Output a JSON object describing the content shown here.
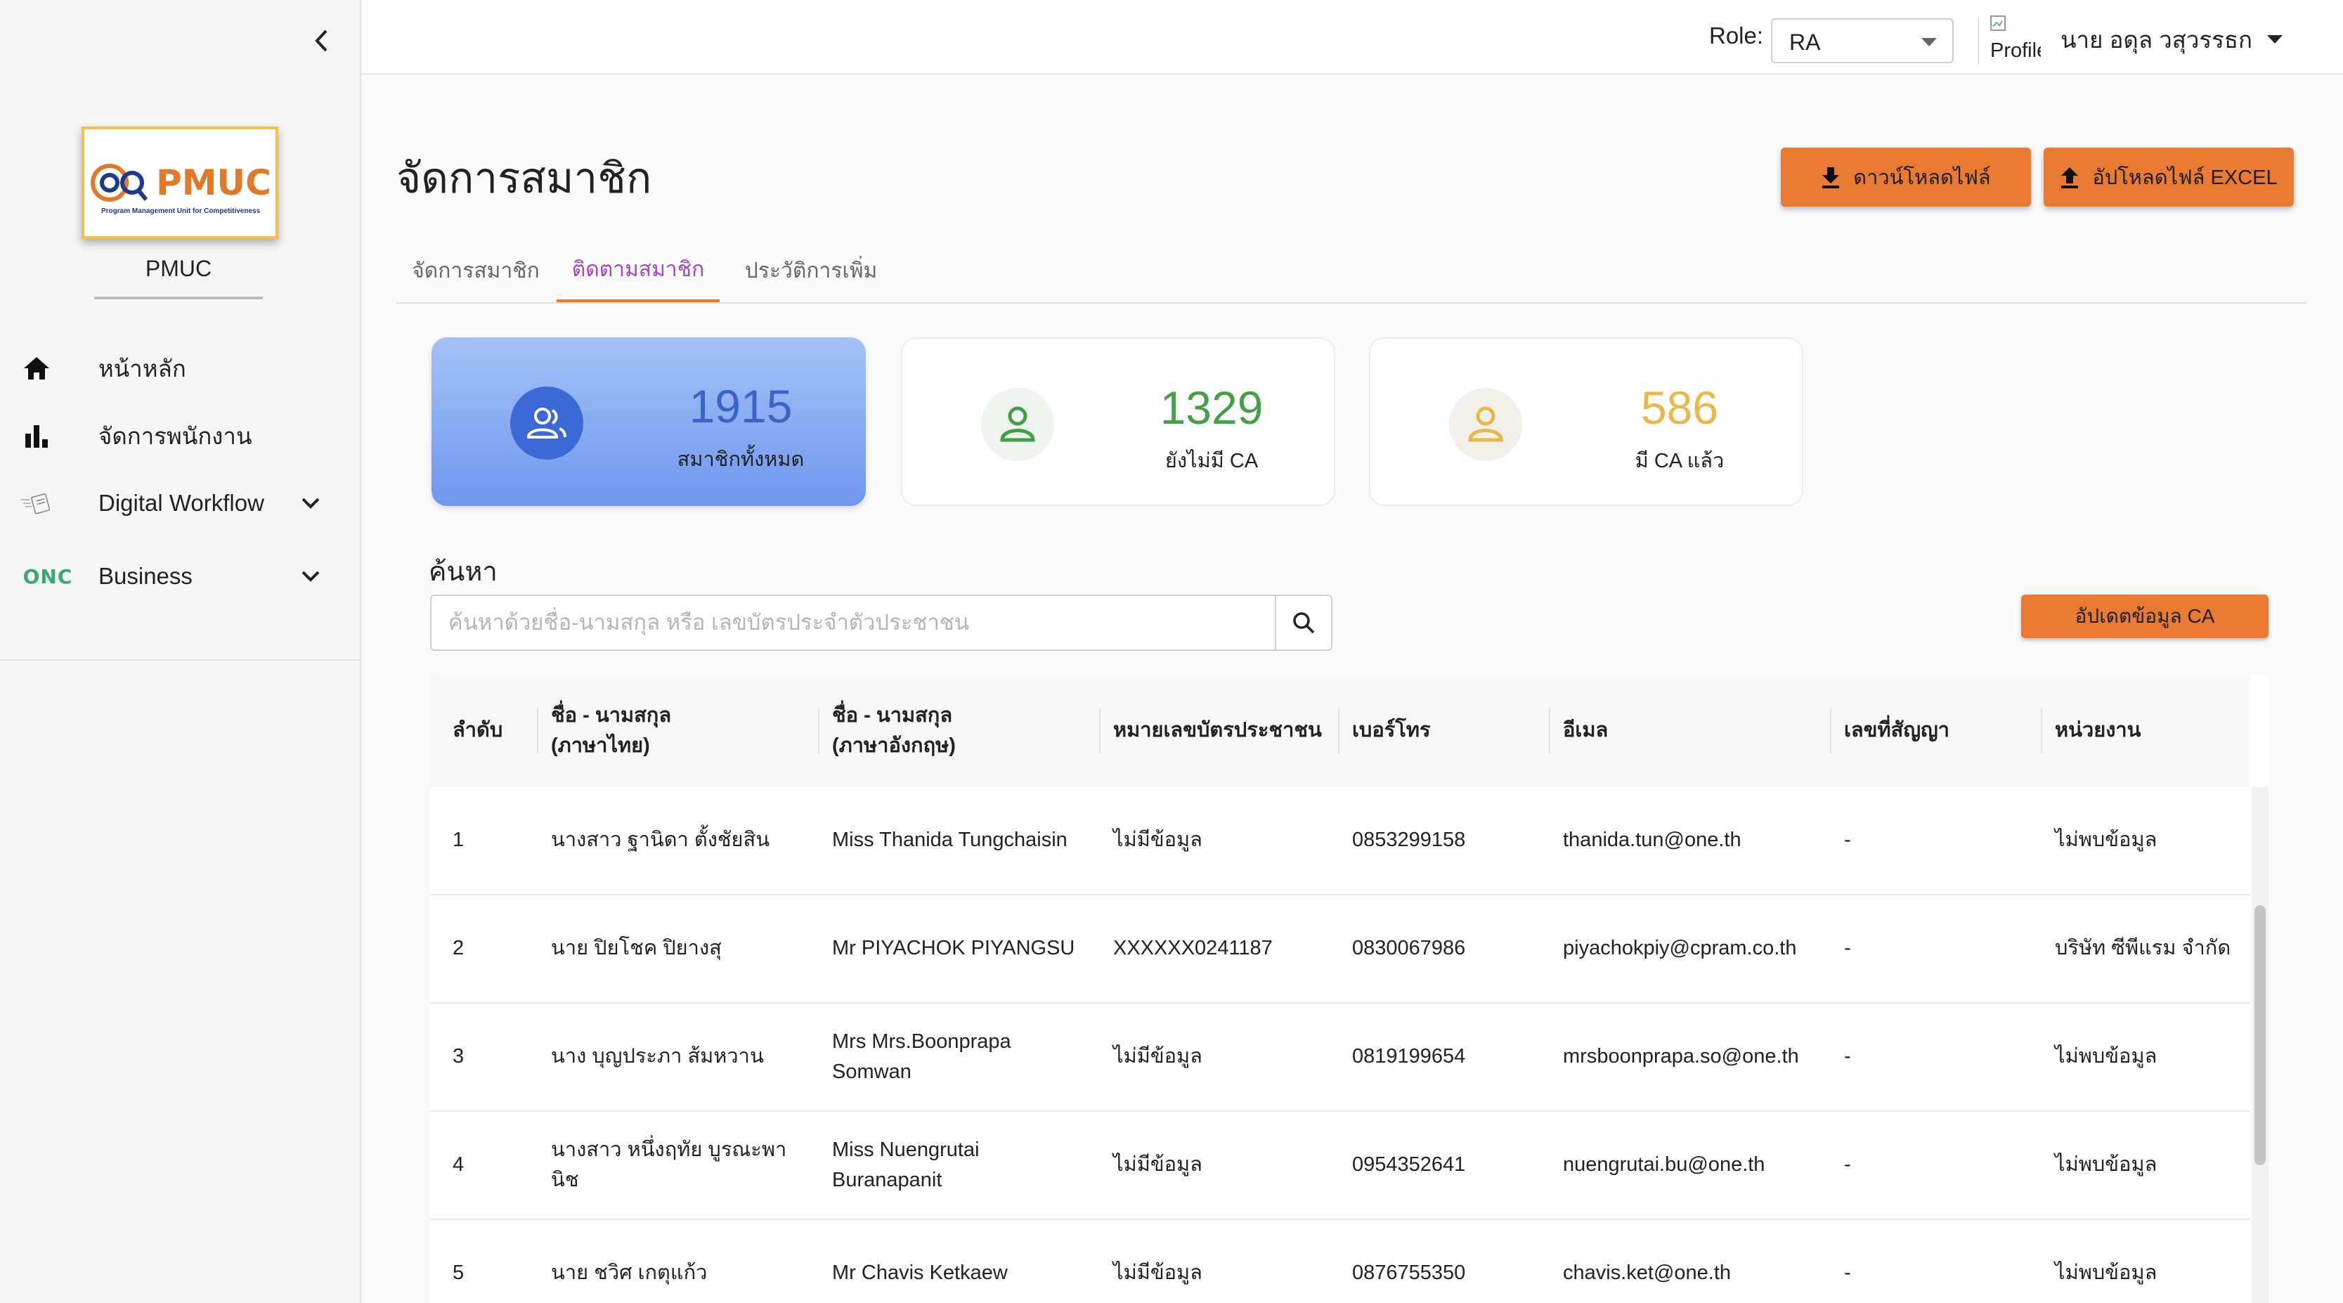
{
  "sidebar": {
    "logo_text": "PMUC",
    "logo_subtitle": "Program Management Unit for Competitiveness",
    "org_name": "PMUC",
    "items": [
      {
        "label": "หน้าหลัก",
        "icon": "home-icon"
      },
      {
        "label": "จัดการพนักงาน",
        "icon": "bar-chart-icon"
      },
      {
        "label": "Digital Workflow",
        "icon": "digital-workflow-icon",
        "expandable": true
      },
      {
        "label": "Business",
        "icon": "onc-logo-icon",
        "expandable": true
      }
    ],
    "onc_text": "ONC"
  },
  "topbar": {
    "role_label": "Role:",
    "role_value": "RA",
    "profile_alt": "Profile",
    "user_name": "นาย อดุล วสุวรรธก"
  },
  "main": {
    "title": "จัดการสมาชิก",
    "download_label": "ดาวน์โหลดไฟล์",
    "upload_label": "อัปโหลดไฟล์ EXCEL",
    "tabs": [
      {
        "label": "จัดการสมาชิก",
        "active": false
      },
      {
        "label": "ติดตามสมาชิก",
        "active": true
      },
      {
        "label": "ประวัติการเพิ่ม",
        "active": false
      }
    ],
    "stats": [
      {
        "value": "1915",
        "label": "สมาชิกทั้งหมด",
        "color": "#3b63c4"
      },
      {
        "value": "1329",
        "label": "ยังไม่มี CA",
        "color": "#43a047"
      },
      {
        "value": "586",
        "label": "มี CA แล้ว",
        "color": "#e8b94a"
      }
    ],
    "search_label": "ค้นหา",
    "search_placeholder": "ค้นหาด้วยชื่อ-นามสกุล หรือ เลขบัตรประจำตัวประชาชน",
    "update_ca_label": "อัปเดตข้อมูล CA"
  },
  "table": {
    "headers": {
      "no": "ลำดับ",
      "name_th_1": "ชื่อ - นามสกุล",
      "name_th_2": "(ภาษาไทย)",
      "name_en_1": "ชื่อ - นามสกุล",
      "name_en_2": "(ภาษาอังกฤษ)",
      "id_card": "หมายเลขบัตรประชาชน",
      "phone": "เบอร์โทร",
      "email": "อีเมล",
      "contract": "เลขที่สัญญา",
      "org": "หน่วยงาน"
    },
    "rows": [
      {
        "no": "1",
        "name_th": "นางสาว ฐานิดา ตั้งชัยสิน",
        "name_en": "Miss Thanida Tungchaisin",
        "id_card": "ไม่มีข้อมูล",
        "phone": "0853299158",
        "email": "thanida.tun@one.th",
        "contract": "-",
        "org": "ไม่พบข้อมูล"
      },
      {
        "no": "2",
        "name_th": "นาย ปิยโชค ปิยางสุ",
        "name_en": "Mr PIYACHOK PIYANGSU",
        "id_card": "XXXXXX0241187",
        "phone": "0830067986",
        "email": "piyachokpiy@cpram.co.th",
        "contract": "-",
        "org": "บริษัท ซีพีแรม จำกัด"
      },
      {
        "no": "3",
        "name_th": "นาง บุญประภา ส้มหวาน",
        "name_en": "Mrs Mrs.Boonprapa Somwan",
        "id_card": "ไม่มีข้อมูล",
        "phone": "0819199654",
        "email": "mrsboonprapa.so@one.th",
        "contract": "-",
        "org": "ไม่พบข้อมูล"
      },
      {
        "no": "4",
        "name_th": "นางสาว หนึ่งฤทัย บูรณะพานิช",
        "name_en": "Miss Nuengrutai Buranapanit",
        "id_card": "ไม่มีข้อมูล",
        "phone": "0954352641",
        "email": "nuengrutai.bu@one.th",
        "contract": "-",
        "org": "ไม่พบข้อมูล"
      },
      {
        "no": "5",
        "name_th": "นาย ชวิศ เกตุแก้ว",
        "name_en": "Mr Chavis Ketkaew",
        "id_card": "ไม่มีข้อมูล",
        "phone": "0876755350",
        "email": "chavis.ket@one.th",
        "contract": "-",
        "org": "ไม่พบข้อมูล"
      }
    ]
  },
  "colors": {
    "accent_orange": "#e87a31",
    "active_tab": "#a345c8",
    "primary_card": "#6f97ee"
  }
}
